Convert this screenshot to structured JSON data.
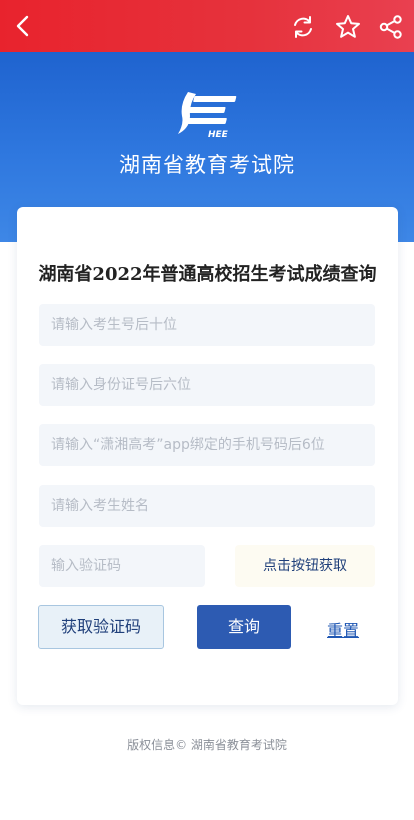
{
  "header": {
    "back_icon": "chevron-left-icon",
    "actions": [
      "refresh-icon",
      "star-icon",
      "share-icon"
    ],
    "bar_color": "#e8232d"
  },
  "hero": {
    "logo_text": "HEE",
    "org_name": "湖南省教育考试院",
    "bg_color": "#2f78df"
  },
  "form": {
    "title": "湖南省2022年普通高校招生考试成绩查询",
    "fields": {
      "exam_no": {
        "value": "",
        "placeholder": "请输入考生号后十位"
      },
      "id_no": {
        "value": "",
        "placeholder": "请输入身份证号后六位"
      },
      "phone": {
        "value": "",
        "placeholder": "请输入“潇湘高考”app绑定的手机号码后6位"
      },
      "name": {
        "value": "",
        "placeholder": "请输入考生姓名"
      },
      "code": {
        "value": "",
        "placeholder": "输入验证码"
      }
    },
    "sms_link_label": "点击按钮获取",
    "buttons": {
      "get_code": "获取验证码",
      "query": "查询",
      "reset": "重置"
    },
    "accent_color": "#2d5bb2"
  },
  "footer": {
    "copyright": "版权信息© 湖南省教育考试院"
  }
}
